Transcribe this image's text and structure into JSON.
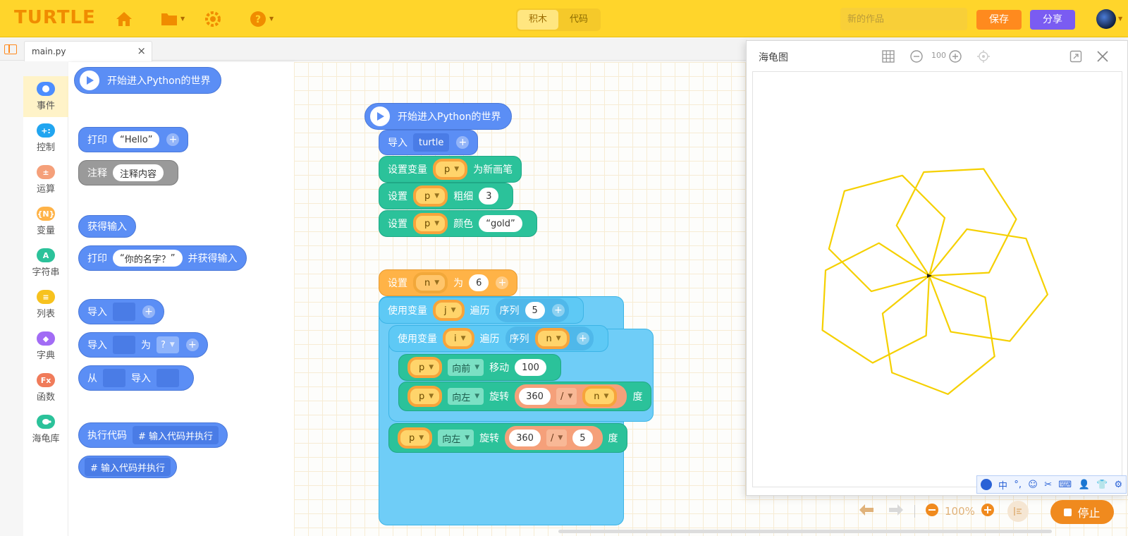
{
  "app": {
    "logo": "TURTLE",
    "mode_tabs": [
      {
        "label": "积木",
        "active": true
      },
      {
        "label": "代码",
        "active": false
      }
    ],
    "title_placeholder": "新的作品",
    "save_label": "保存",
    "share_label": "分享"
  },
  "tabs": {
    "file_name": "main.py",
    "close": "×"
  },
  "categories": [
    {
      "label": "事件",
      "color": "#4c8dff",
      "glyph": "●"
    },
    {
      "label": "控制",
      "color": "#21a5f0",
      "glyph": "+:"
    },
    {
      "label": "运算",
      "color": "#f5a07a",
      "glyph": "±"
    },
    {
      "label": "变量",
      "color": "#ffb347",
      "glyph": "{N}"
    },
    {
      "label": "字符串",
      "color": "#2bc29a",
      "glyph": "A"
    },
    {
      "label": "列表",
      "color": "#f7c21e",
      "glyph": "≡"
    },
    {
      "label": "字典",
      "color": "#a26cf5",
      "glyph": "◆"
    },
    {
      "label": "函数",
      "color": "#f07b5a",
      "glyph": "Fx"
    },
    {
      "label": "海龟库",
      "color": "#2bc29a",
      "glyph": "🐢"
    }
  ],
  "palette": {
    "start": "开始进入Python的世界",
    "print": "打印",
    "hello": "Hello",
    "comment": "注释",
    "comment_value": "注释内容",
    "get_input": "获得输入",
    "print2": "打印",
    "prompt": "你的名字？",
    "and_input": "并获得输入",
    "import1": "导入",
    "import2": "导入",
    "as": "为",
    "as_value": "?",
    "from": "从",
    "from_import": "导入",
    "exec": "执行代码",
    "exec_value": "# 输入代码并执行",
    "code_only": "# 输入代码并执行"
  },
  "program": {
    "start": "开始进入Python的世界",
    "import_label": "导入",
    "import_value": "turtle",
    "set_var": "设置变量",
    "var_p": "p",
    "new_pen": "为新画笔",
    "set": "设置",
    "width_label": "粗细",
    "width_value": "3",
    "color_label": "颜色",
    "color_value": "gold",
    "set_n": "设置",
    "var_n": "n",
    "as_label": "为",
    "n_value": "6",
    "use_var": "使用变量",
    "var_j": "j",
    "iterate": "遍历",
    "range": "序列",
    "range_j": "5",
    "var_i": "i",
    "range_i": "n",
    "dir_forward": "向前",
    "move": "移动",
    "forward_value": "100",
    "dir_left": "向左",
    "rotate": "旋转",
    "full": "360",
    "div": "/",
    "div_n": "n",
    "degree": "度",
    "div_5": "5"
  },
  "turtle_window": {
    "title": "海龟图",
    "zoom": "100",
    "stroke_color": "#f5d000"
  },
  "bottom": {
    "zoom": "100%",
    "stop": "停止"
  },
  "ime": [
    "中",
    "°,",
    "☺",
    "✂",
    "⌨",
    "👤",
    "👕",
    "⚙"
  ]
}
